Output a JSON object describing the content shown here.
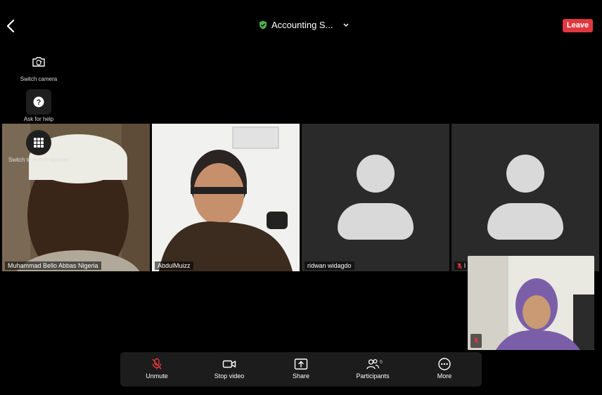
{
  "meeting": {
    "title": "Accounting S...",
    "leave_label": "Leave"
  },
  "side_controls": [
    {
      "label": "Switch camera"
    },
    {
      "label": "Ask for help"
    },
    {
      "label": "Switch to active speaker"
    }
  ],
  "participants": [
    {
      "name": "Muhammad Bello Abbas Nigeria",
      "video": "on",
      "muted": false,
      "active": false
    },
    {
      "name": "AbdulMuizz",
      "video": "on",
      "muted": false,
      "active": true
    },
    {
      "name": "ridwan widagdo",
      "video": "off",
      "muted": false,
      "active": false
    },
    {
      "name": "l",
      "video": "off",
      "muted": true,
      "active": false
    }
  ],
  "self_view": {
    "muted": true
  },
  "toolbar": {
    "unmute": "Unmute",
    "stop_video": "Stop video",
    "share": "Share",
    "participants": "Participants",
    "participants_count": "6",
    "more": "More"
  },
  "colors": {
    "leave": "#e0383e",
    "active_border": "#6fcf6f",
    "muted_red": "#e0383e",
    "shield": "#4caf50"
  }
}
